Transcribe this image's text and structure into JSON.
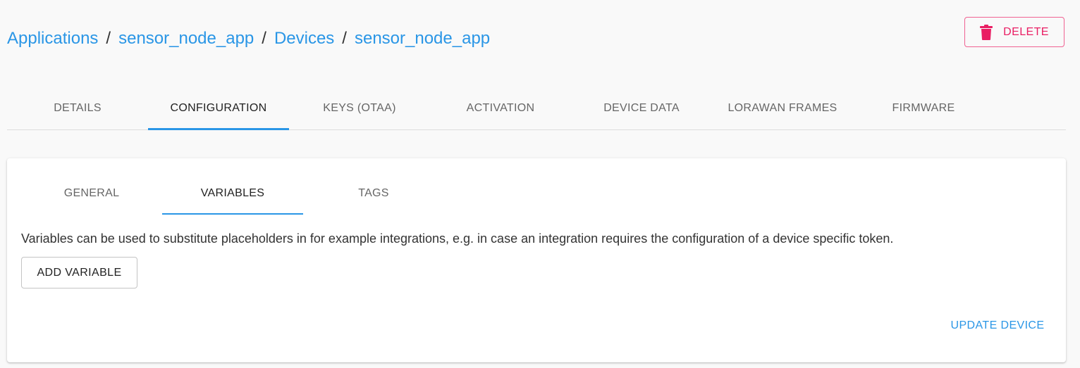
{
  "breadcrumb": {
    "items": [
      {
        "label": "Applications"
      },
      {
        "label": "sensor_node_app"
      },
      {
        "label": "Devices"
      },
      {
        "label": "sensor_node_app"
      }
    ],
    "separator": "/"
  },
  "header": {
    "delete_label": "DELETE",
    "delete_icon": "trash-icon",
    "delete_color": "#e91e63"
  },
  "main_tabs": [
    {
      "label": "DETAILS",
      "active": false
    },
    {
      "label": "CONFIGURATION",
      "active": true
    },
    {
      "label": "KEYS (OTAA)",
      "active": false
    },
    {
      "label": "ACTIVATION",
      "active": false
    },
    {
      "label": "DEVICE DATA",
      "active": false
    },
    {
      "label": "LORAWAN FRAMES",
      "active": false
    },
    {
      "label": "FIRMWARE",
      "active": false
    }
  ],
  "sub_tabs": [
    {
      "label": "GENERAL",
      "active": false
    },
    {
      "label": "VARIABLES",
      "active": true
    },
    {
      "label": "TAGS",
      "active": false
    }
  ],
  "variables": {
    "description": "Variables can be used to substitute placeholders in for example integrations, e.g. in case an integration requires the configuration of a device specific token.",
    "add_label": "ADD VARIABLE"
  },
  "footer": {
    "update_label": "UPDATE DEVICE"
  },
  "colors": {
    "accent": "#2a96e6",
    "danger": "#e91e63",
    "background": "#f9f9f9"
  }
}
